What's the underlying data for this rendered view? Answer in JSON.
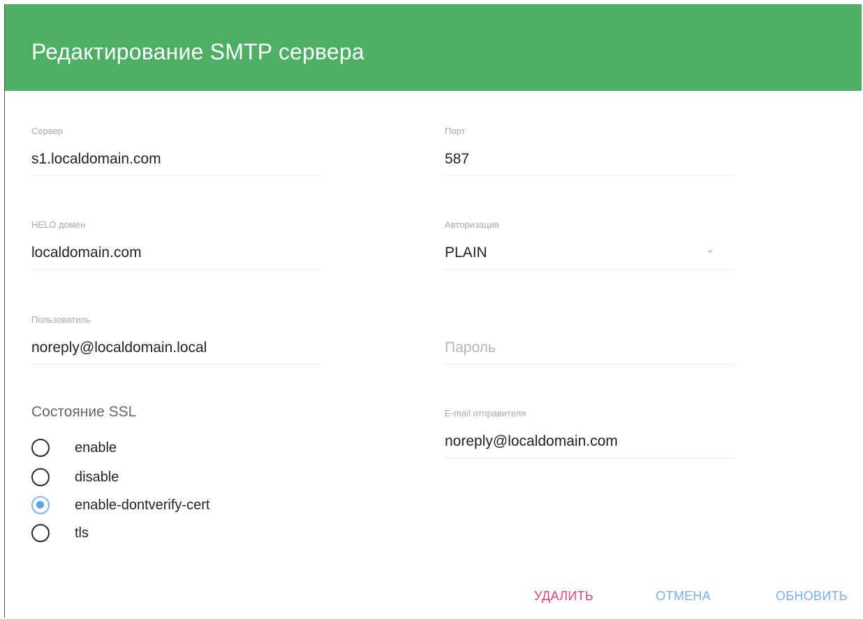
{
  "dialog": {
    "title": "Редактирование SMTP сервера"
  },
  "fields": {
    "server": {
      "label": "Сервер",
      "value": "s1.localdomain.com"
    },
    "port": {
      "label": "Порт",
      "value": "587"
    },
    "helo": {
      "label": "HELO домен",
      "value": "localdomain.com"
    },
    "auth": {
      "label": "Авторизация",
      "value": "PLAIN"
    },
    "user": {
      "label": "Пользователь",
      "value": "noreply@localdomain.local"
    },
    "password": {
      "placeholder": "Пароль"
    },
    "sender": {
      "label": "E-mail отправителя",
      "value": "noreply@localdomain.com"
    }
  },
  "ssl": {
    "label": "Состояние SSL",
    "options": [
      {
        "label": "enable",
        "checked": false
      },
      {
        "label": "disable",
        "checked": false
      },
      {
        "label": "enable-dontverify-cert",
        "checked": true
      },
      {
        "label": "tls",
        "checked": false
      }
    ]
  },
  "actions": {
    "delete": "УДАЛИТЬ",
    "cancel": "ОТМЕНА",
    "update": "ОБНОВИТЬ"
  },
  "colors": {
    "header": "#4caf64",
    "delete": "#e2427a",
    "primary": "#78b0ec",
    "radio_checked": "#5aa4ea"
  }
}
